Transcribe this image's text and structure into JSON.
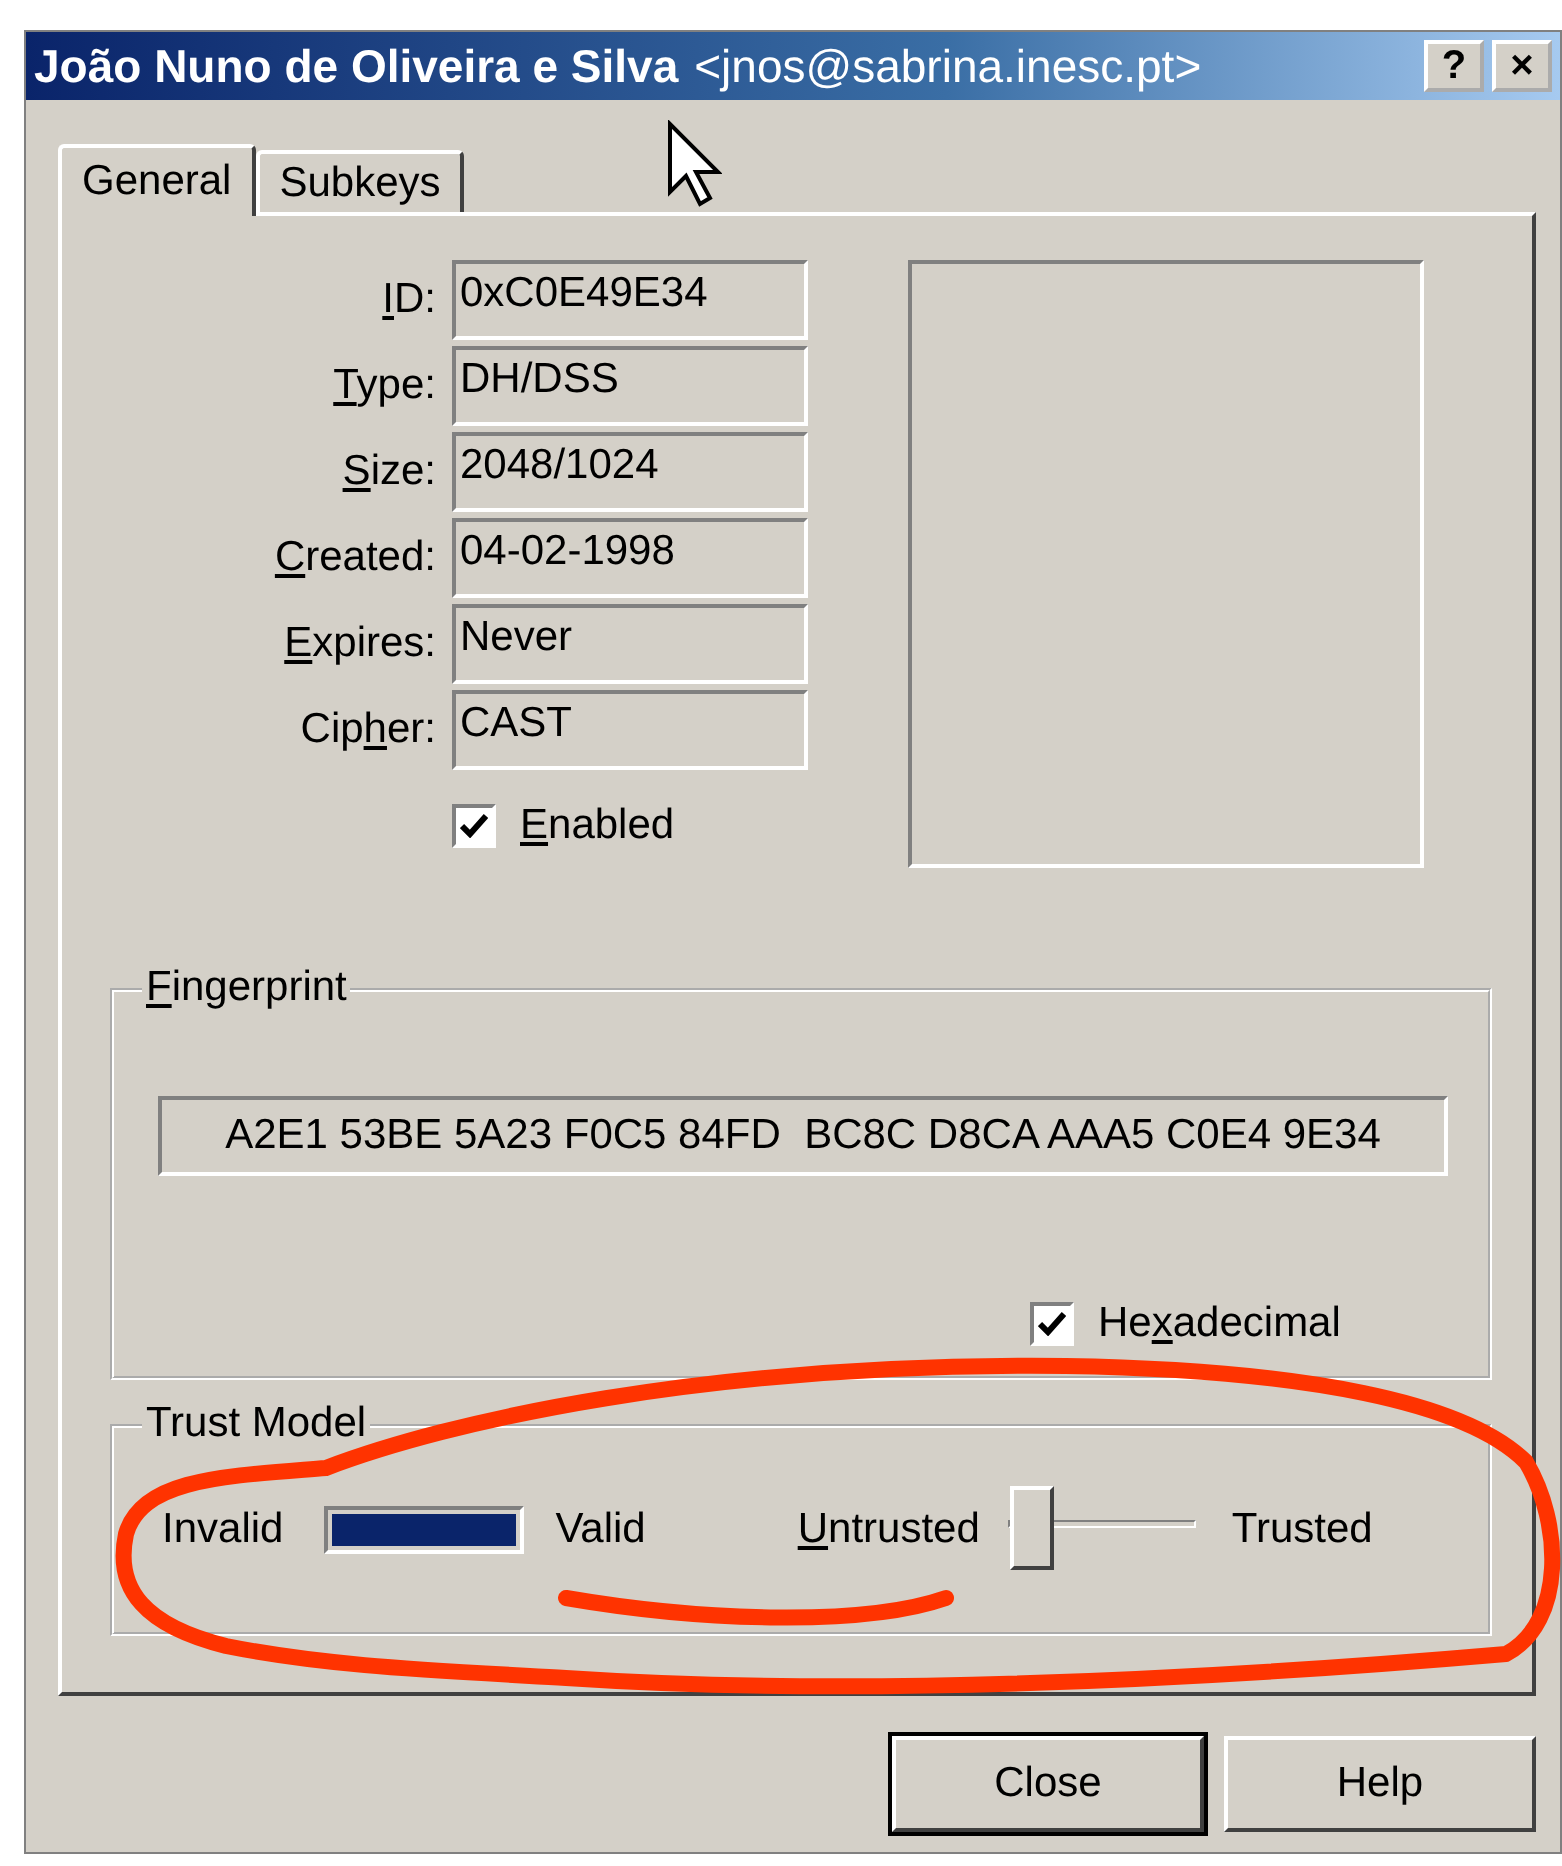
{
  "window": {
    "title": "João Nuno de Oliveira e Silva",
    "title_suffix": "<jnos@sabrina.inesc.pt>",
    "buttons": [
      "?",
      "×"
    ]
  },
  "tabs": [
    {
      "label": "General",
      "selected": true
    },
    {
      "label": "Subkeys",
      "selected": false
    }
  ],
  "fields": [
    {
      "label": {
        "key": "I",
        "after": "D:"
      },
      "value": "0xC0E49E34"
    },
    {
      "label": {
        "key": "T",
        "after": "ype:"
      },
      "value": "DH/DSS"
    },
    {
      "label": {
        "key": "S",
        "after": "ize:"
      },
      "value": "2048/1024"
    },
    {
      "label": {
        "key": "C",
        "after": "reated:"
      },
      "value": "04-02-1998"
    },
    {
      "label": {
        "key": "E",
        "after": "xpires:"
      },
      "value": "Never"
    },
    {
      "label": {
        "before": "Cip",
        "key": "h",
        "after": "er:"
      },
      "value": "CAST"
    }
  ],
  "enabled": {
    "label": {
      "key": "E",
      "after": "nabled"
    },
    "checked": true
  },
  "fingerprint": {
    "title": {
      "key": "F",
      "after": "ingerprint"
    },
    "value": "A2E1 53BE 5A23 F0C5 84FD  BC8C D8CA AAA5 C0E4 9E34",
    "hexadecimal": {
      "label": {
        "before": "He",
        "key": "x",
        "after": "adecimal"
      },
      "checked": true
    }
  },
  "trust_model": {
    "title": "Trust Model",
    "validity": {
      "low_label": "Invalid",
      "high_label": "Valid",
      "level": 1
    },
    "trust": {
      "low_label": {
        "key": "U",
        "after": "ntrusted"
      },
      "high_label": "Trusted",
      "level": 0
    }
  },
  "buttons": [
    {
      "label": "Close",
      "default": true
    },
    {
      "label": "Help",
      "default": false
    }
  ]
}
